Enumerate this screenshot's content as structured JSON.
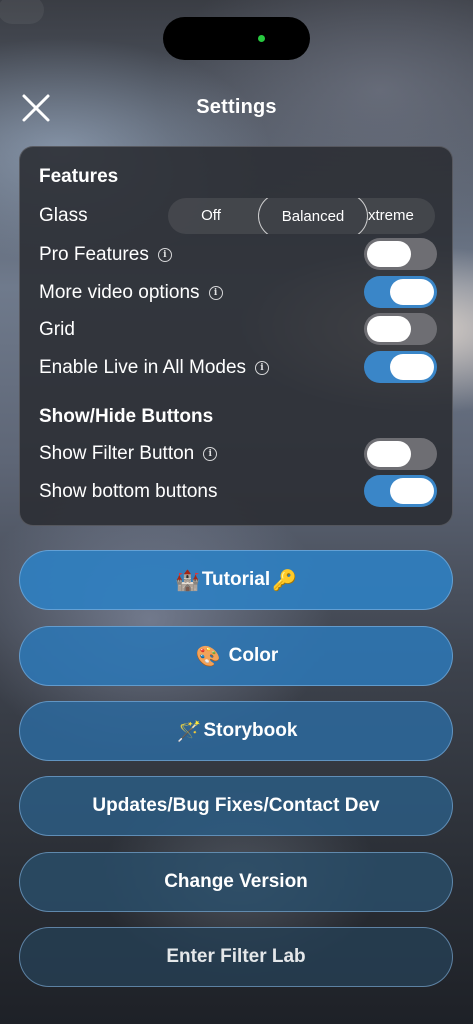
{
  "header": {
    "title": "Settings",
    "close_icon": "close-icon"
  },
  "features": {
    "section_title": "Features",
    "glass": {
      "label": "Glass",
      "options": [
        "Off",
        "Balanced",
        "xtreme"
      ],
      "selected": "Balanced"
    },
    "rows": [
      {
        "label": "Pro Features",
        "info": true,
        "on": false
      },
      {
        "label": "More video options",
        "info": true,
        "on": true
      },
      {
        "label": "Grid",
        "info": false,
        "on": false
      },
      {
        "label": "Enable Live in All Modes",
        "info": true,
        "on": true
      }
    ]
  },
  "show_hide": {
    "section_title": "Show/Hide Buttons",
    "rows": [
      {
        "label": "Show Filter Button",
        "info": true,
        "on": false
      },
      {
        "label": "Show bottom buttons",
        "info": false,
        "on": true
      }
    ]
  },
  "buttons": {
    "tutorial": {
      "label": "Tutorial",
      "emoji_before": "🏰",
      "emoji_after": "🔑"
    },
    "color": {
      "label": "Color",
      "emoji_before": "🎨"
    },
    "storybook": {
      "label": "Storybook",
      "emoji_before": "🪄"
    },
    "updates": {
      "label": "Updates/Bug Fixes/Contact Dev"
    },
    "change_version": {
      "label": "Change Version"
    },
    "filter_lab": {
      "label": "Enter Filter Lab"
    }
  },
  "colors": {
    "toggle_on": "#3a86c8",
    "toggle_off": "#6e6e73",
    "button_fill_top": "#2f7fc0",
    "button_fill_bottom": "#2b4558"
  }
}
